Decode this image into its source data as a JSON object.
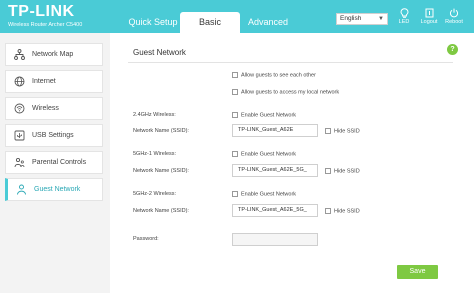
{
  "brand": {
    "logo": "TP-LINK",
    "model": "Wireless Router Archer C5400"
  },
  "tabs": {
    "quick_setup": "Quick Setup",
    "basic": "Basic",
    "advanced": "Advanced"
  },
  "language": {
    "selected": "English"
  },
  "header_icons": {
    "led": "LED",
    "logout": "Logout",
    "reboot": "Reboot"
  },
  "sidebar": {
    "items": [
      {
        "label": "Network Map",
        "icon": "network-map-icon"
      },
      {
        "label": "Internet",
        "icon": "globe-icon"
      },
      {
        "label": "Wireless",
        "icon": "wifi-icon"
      },
      {
        "label": "USB Settings",
        "icon": "usb-icon"
      },
      {
        "label": "Parental Controls",
        "icon": "parental-icon"
      },
      {
        "label": "Guest Network",
        "icon": "guest-icon",
        "active": true
      }
    ]
  },
  "content": {
    "title": "Guest Network",
    "help": "?",
    "allow_see_each_other": "Allow guests to see each other",
    "allow_local_network": "Allow guests to access my local network",
    "band_24": {
      "label": "2.4GHz Wireless:",
      "enable": "Enable Guest Network",
      "ssid_label": "Network Name (SSID):",
      "ssid": "TP-LINK_Guest_A62E",
      "hide": "Hide SSID"
    },
    "band_5_1": {
      "label": "5GHz-1 Wireless:",
      "enable": "Enable Guest Network",
      "ssid_label": "Network Name (SSID):",
      "ssid": "TP-LINK_Guest_A62E_5G_",
      "hide": "Hide SSID"
    },
    "band_5_2": {
      "label": "5GHz-2 Wireless:",
      "enable": "Enable Guest Network",
      "ssid_label": "Network Name (SSID):",
      "ssid": "TP-LINK_Guest_A62E_5G_",
      "hide": "Hide SSID"
    },
    "password_label": "Password:",
    "password_value": "",
    "save": "Save"
  },
  "colors": {
    "header": "#4acbd6",
    "accent_green": "#7ec942",
    "active_text": "#2aa8b5"
  }
}
